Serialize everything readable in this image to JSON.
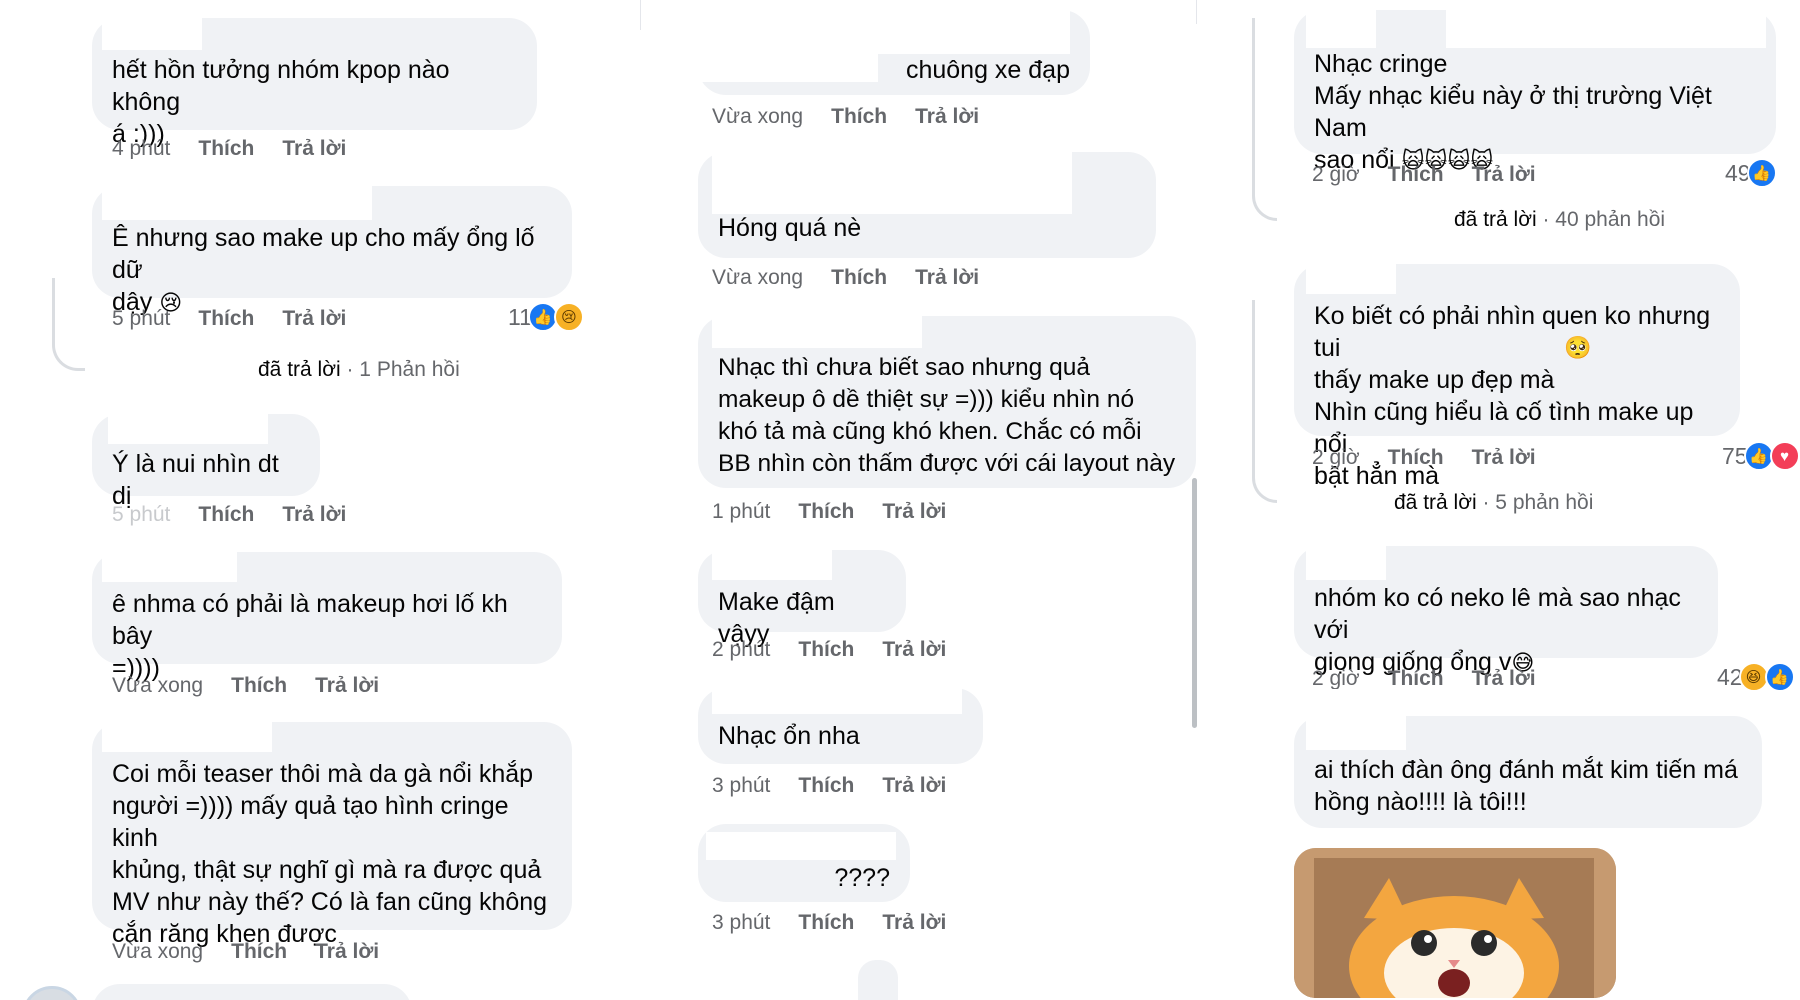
{
  "col1": {
    "comments": [
      {
        "text": "hết hồn tưởng nhóm kpop nào không\ná :)))",
        "time": "4 phút",
        "like": "Thích",
        "reply": "Trả lời"
      },
      {
        "text": "Ê nhưng sao make up cho mấy ổng lố dữ\ndậy",
        "time": "5 phút",
        "like": "Thích",
        "reply": "Trả lời",
        "reaction_count": "11",
        "reactions": [
          "like-icon",
          "sad-icon"
        ]
      },
      {
        "text": "Ý là nui nhìn dt dị",
        "time": "5 phút",
        "like": "Thích",
        "reply": "Trả lời"
      },
      {
        "text": "ê nhma có phải là makeup hơi lố kh bây\n=))))",
        "time": "Vừa xong",
        "like": "Thích",
        "reply": "Trả lời"
      },
      {
        "text": "Coi mỗi teaser thôi mà da gà nổi khắp\nngười =)))) mấy quả tạo hình cringe kinh\nkhủng, thật sự nghĩ gì mà ra được quả\nMV như này thế? Có là fan cũng không\ncắn răng khen được",
        "time": "Vừa xong",
        "like": "Thích",
        "reply": "Trả lời"
      }
    ],
    "replies_summary": {
      "prefix": "đã trả lời",
      "count": "· 1 Phản hồi"
    }
  },
  "col2": {
    "comments": [
      {
        "text": "chuông xe đạp",
        "time": "Vừa xong",
        "like": "Thích",
        "reply": "Trả lời"
      },
      {
        "text": "Hóng quá nè",
        "time": "Vừa xong",
        "like": "Thích",
        "reply": "Trả lời"
      },
      {
        "text": "Nhạc thì chưa biết sao nhưng quả\nmakeup ô dề thiệt sự =))) kiểu nhìn nó\nkhó tả mà cũng khó khen. Chắc có mỗi\nBB nhìn còn thấm được với cái layout này",
        "time": "1 phút",
        "like": "Thích",
        "reply": "Trả lời"
      },
      {
        "text": "Make đậm vậyy",
        "time": "2 phút",
        "like": "Thích",
        "reply": "Trả lời"
      },
      {
        "text": "Nhạc ổn nha",
        "time": "3 phút",
        "like": "Thích",
        "reply": "Trả lời"
      },
      {
        "text": "????",
        "time": "3 phút",
        "like": "Thích",
        "reply": "Trả lời"
      }
    ]
  },
  "col3": {
    "comments": [
      {
        "text": "Nhạc cringe\nMấy nhạc kiểu này ở thị trường Việt Nam\nsao nổi",
        "time": "2 giờ",
        "like": "Thích",
        "reply": "Trả lời",
        "reaction_count": "49",
        "reactions": [
          "like-icon"
        ]
      },
      {
        "text": "Ko biết có phải nhìn quen ko nhưng tui\nthấy make up đẹp mà\nNhìn cũng hiểu là cố tình make up nổi\nbật hẳn mà",
        "time": "2 giờ",
        "like": "Thích",
        "reply": "Trả lời",
        "reaction_count": "75",
        "reactions": [
          "like-icon",
          "love-icon"
        ]
      },
      {
        "text": "nhóm ko có neko lê mà sao nhạc với\ngiọng giống ổng v",
        "time": "2 giờ",
        "like": "Thích",
        "reply": "Trả lời",
        "reaction_count": "42",
        "reactions": [
          "haha-icon",
          "like-icon"
        ]
      },
      {
        "text": "ai thích đàn ông đánh mắt kim tiến má\nhồng nào!!!! là tôi!!!"
      }
    ],
    "replies_summary_1": {
      "prefix": "đã trả lời",
      "count": "· 40 phản hồi"
    },
    "replies_summary_2": {
      "prefix": "đã trả lời",
      "count": "· 5 phản hồi"
    }
  },
  "colors": {
    "bubble": "#f0f2f5",
    "meta": "#65676b",
    "like": "#1877f2",
    "love": "#f33e58",
    "haha": "#f7b125"
  }
}
